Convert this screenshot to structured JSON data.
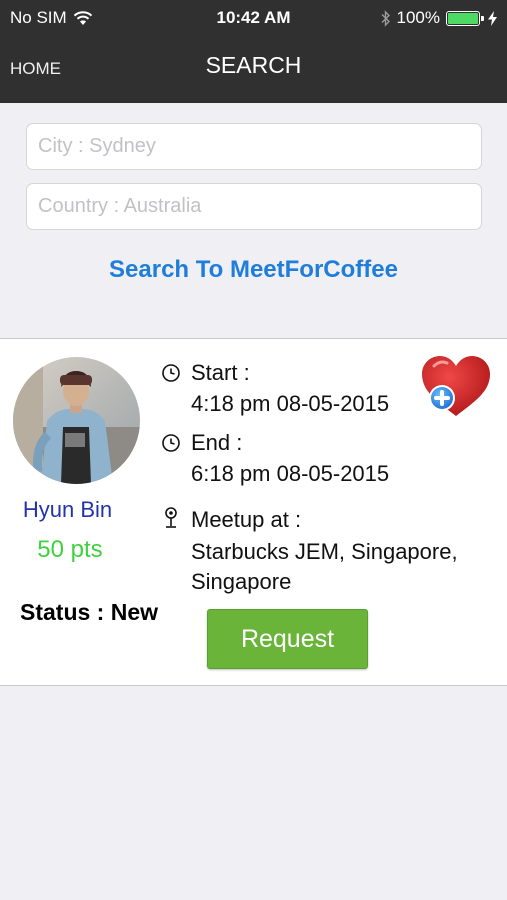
{
  "status_bar": {
    "carrier": "No SIM",
    "time": "10:42 AM",
    "battery": "100%",
    "battery_level": 1.0
  },
  "nav": {
    "back_label": "HOME",
    "title": "SEARCH"
  },
  "search": {
    "city_placeholder": "City : Sydney",
    "country_placeholder": "Country : Australia",
    "search_link": "Search To MeetForCoffee"
  },
  "result": {
    "name": "Hyun Bin",
    "points": "50 pts",
    "status": "Status : New",
    "start_label": "Start :",
    "start_value": "4:18 pm 08-05-2015",
    "end_label": "End :",
    "end_value": "6:18 pm 08-05-2015",
    "meetup_label": "Meetup at :",
    "meetup_value_line1": "Starbucks JEM, Singapore,",
    "meetup_value_line2": "Singapore",
    "request_button": "Request"
  },
  "colors": {
    "nav_background": "#303030",
    "link_blue": "#1f7ed9",
    "name_blue": "#2333aa",
    "points_green": "#3fd13f",
    "button_green": "#6ab43a",
    "battery_green": "#4cd964"
  },
  "icons": {
    "wifi": "wifi-icon",
    "bluetooth": "bluetooth-icon",
    "battery": "battery-icon",
    "charging": "charging-bolt-icon",
    "clock": "clock-icon",
    "pin": "map-pin-icon",
    "favorite": "heart-plus-icon"
  }
}
